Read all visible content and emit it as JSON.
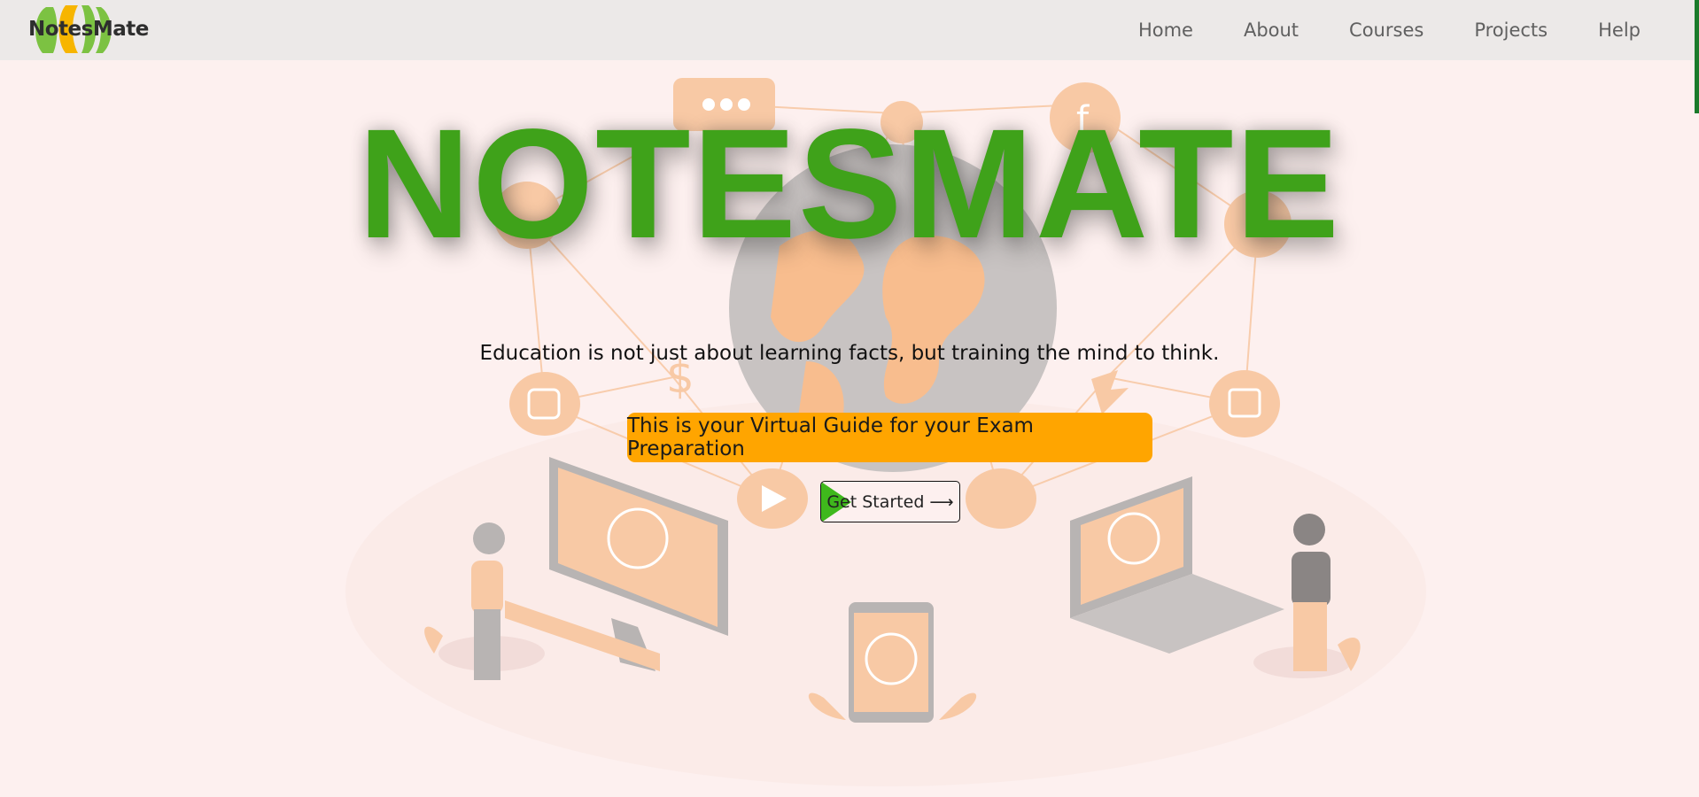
{
  "brand": {
    "name": "NotesMate",
    "colors": {
      "green": "#7cc242",
      "orange": "#f7b500",
      "accent": "#3fa21a"
    }
  },
  "nav": {
    "items": [
      {
        "label": "Home"
      },
      {
        "label": "About"
      },
      {
        "label": "Courses"
      },
      {
        "label": "Projects"
      },
      {
        "label": "Help"
      }
    ]
  },
  "hero": {
    "title": "NOTESMATE",
    "quote": "Education is not just about learning facts, but training the mind to think.",
    "banner": "This is your Virtual Guide for your Exam Preparation",
    "cta_label": "Get Started ⟶",
    "illustration": {
      "icons": [
        "chat-bubble-icon",
        "facebook-icon",
        "instagram-icon",
        "twitter-icon",
        "dollar-icon",
        "image-icon",
        "play-icon",
        "thumbs-up-icon",
        "user-icon",
        "globe-icon"
      ]
    }
  },
  "colors": {
    "page_bg": "#fdf0ef",
    "nav_bg": "#ece9e8",
    "banner_bg": "#ffa500",
    "cta_accent": "#3fb81c"
  }
}
